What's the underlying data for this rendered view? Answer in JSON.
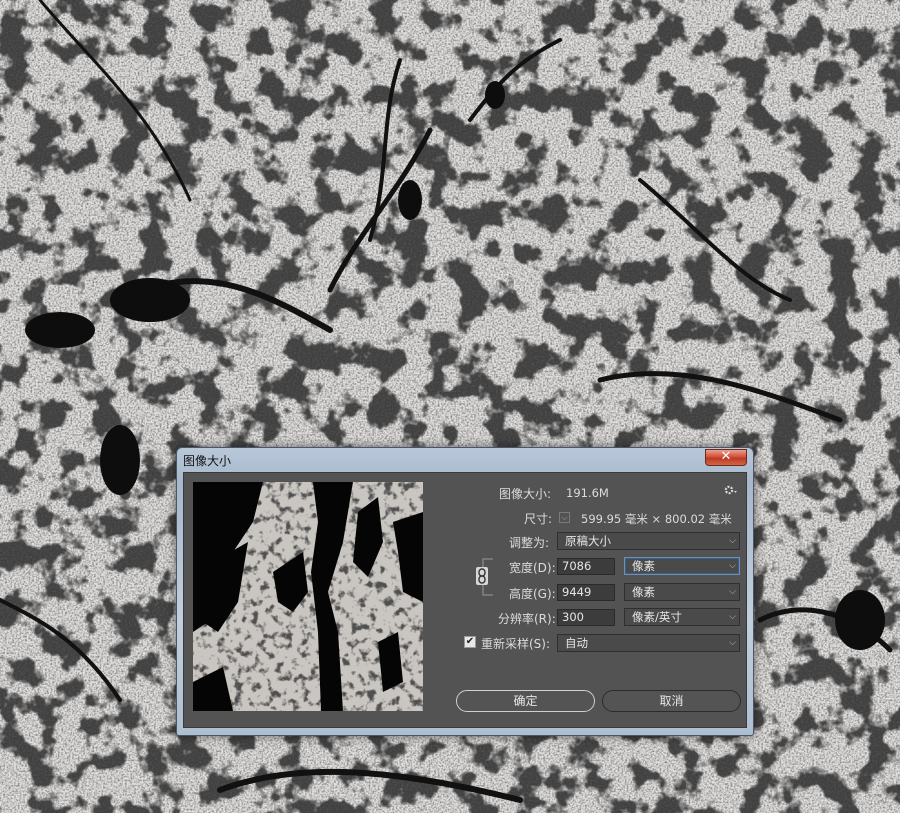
{
  "dialog": {
    "title": "图像大小",
    "close_icon": "✕",
    "image_size_label": "图像大小:",
    "image_size_value": "191.6M",
    "dimensions_label": "尺寸:",
    "dimensions_value": "599.95 毫米  ×  800.02 毫米",
    "fit_to_label": "调整为:",
    "fit_to_value": "原稿大小",
    "width_label": "宽度(D):",
    "width_value": "7086",
    "width_unit": "像素",
    "height_label": "高度(G):",
    "height_value": "9449",
    "height_unit": "像素",
    "resolution_label": "分辨率(R):",
    "resolution_value": "300",
    "resolution_unit": "像素/英寸",
    "resample_label": "重新采样(S):",
    "resample_checked": true,
    "resample_value": "自动",
    "ok_label": "确定",
    "cancel_label": "取消"
  },
  "icons": {
    "gear": "gear-icon",
    "link": "chain-link-icon",
    "chevron": "chevron-down-icon",
    "close": "close-icon"
  },
  "colors": {
    "panel_bg": "#535353",
    "field_bg": "#3c3c3c",
    "text": "#dcdcdc",
    "title_bar": "#b9c8d9",
    "close_button": "#d2503a"
  }
}
